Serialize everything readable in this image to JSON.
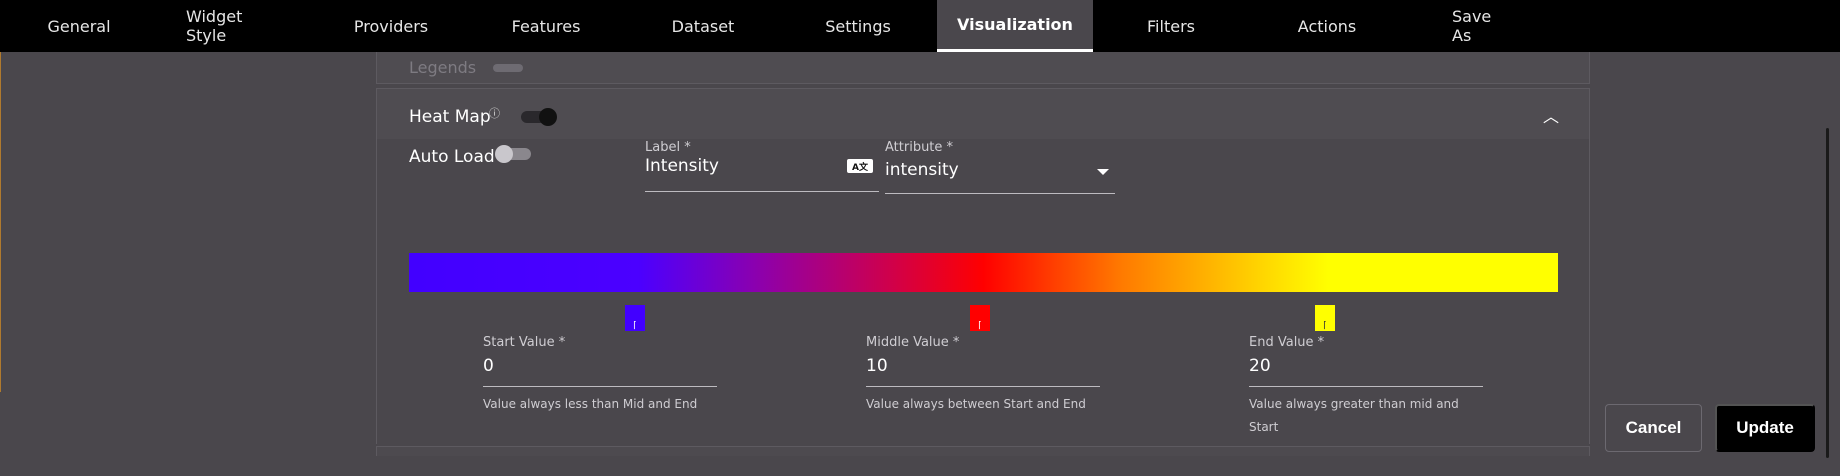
{
  "tabs": [
    {
      "label": "General",
      "active": false
    },
    {
      "label": "Widget Style",
      "active": false
    },
    {
      "label": "Providers",
      "active": false
    },
    {
      "label": "Features",
      "active": false
    },
    {
      "label": "Dataset",
      "active": false
    },
    {
      "label": "Settings",
      "active": false
    },
    {
      "label": "Visualization",
      "active": true
    },
    {
      "label": "Filters",
      "active": false
    },
    {
      "label": "Actions",
      "active": false
    },
    {
      "label": "Save As",
      "active": false
    }
  ],
  "legends": {
    "label": "Legends",
    "toggle_on": false
  },
  "heatmap": {
    "title": "Heat Map",
    "info_icon": "info-icon",
    "enabled": true,
    "auto_load": {
      "label": "Auto Load",
      "on": false
    },
    "label_field": {
      "label": "Label *",
      "value": "Intensity",
      "icon": "translate-icon",
      "icon_text": "A文"
    },
    "attribute_field": {
      "label": "Attribute *",
      "value": "intensity"
    },
    "gradient": {
      "colors": {
        "start": "#4200ff",
        "middle": "#ff0000",
        "end": "#ffff00"
      }
    },
    "start": {
      "label": "Start Value *",
      "value": "0",
      "helper": "Value always less than Mid and End"
    },
    "middle": {
      "label": "Middle Value *",
      "value": "10",
      "helper": "Value always between Start and End"
    },
    "end": {
      "label": "End Value *",
      "value": "20",
      "helper": "Value always greater than mid and Start"
    }
  },
  "actions": {
    "cancel_label": "Cancel",
    "update_label": "Update"
  }
}
